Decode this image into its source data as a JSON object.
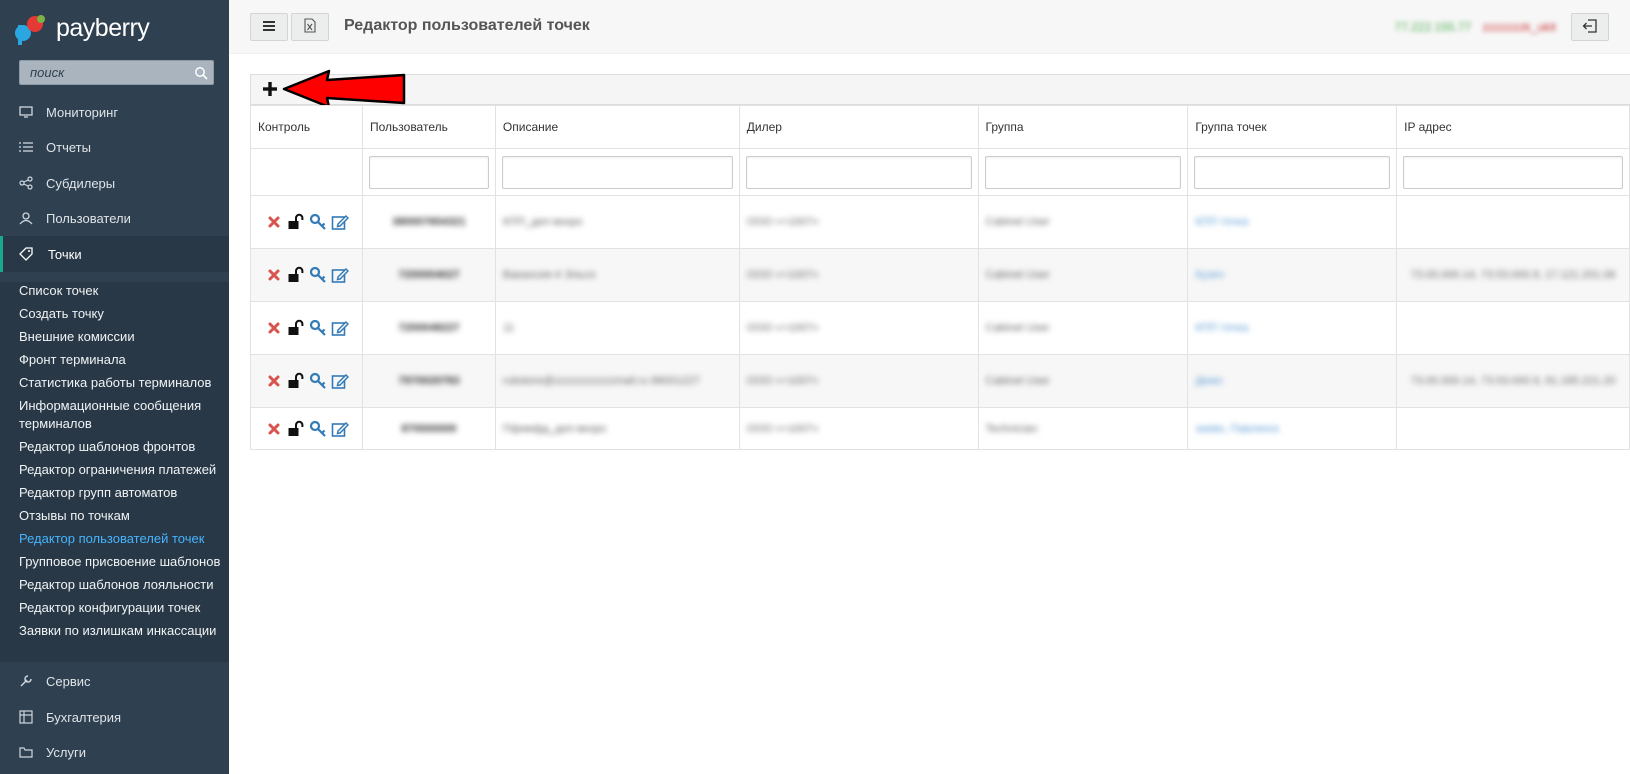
{
  "brand": {
    "name": "payberry"
  },
  "search": {
    "placeholder": "поиск"
  },
  "nav": {
    "monitoring": "Мониторинг",
    "reports": "Отчеты",
    "subdealers": "Субдилеры",
    "users": "Пользователи",
    "points": "Точки",
    "service": "Сервис",
    "accounting": "Бухгалтерия",
    "services": "Услуги"
  },
  "submenu": [
    "Список точек",
    "Создать точку",
    "Внешние комиссии",
    "Фронт терминала",
    "Статистика работы терминалов",
    "Информационные сообщения терминалов",
    "Редактор шаблонов фронтов",
    "Редактор ограничения платежей",
    "Редактор групп автоматов",
    "Отзывы по точкам",
    "Редактор пользователей точек",
    "Групповое присвоение шаблонов",
    "Редактор шаблонов лояльности",
    "Редактор конфигурации точек",
    "Заявки по излишкам инкассации"
  ],
  "topbar": {
    "title": "Редактор пользователей точек",
    "ip": "77.222.155.77",
    "username": "zzzzzzzk_ukit"
  },
  "table": {
    "headers": [
      "Контроль",
      "Пользователь",
      "Описание",
      "Дилер",
      "Группа",
      "Группа точек",
      "IP адрес"
    ],
    "rows": [
      {
        "user": "380007654321",
        "desc": "КПП_деп-вкоро",
        "dealer": "ООО «+1007»",
        "group": "Cabinet User",
        "point_group": "КПП точка",
        "ip": ""
      },
      {
        "user": "7200004027",
        "desc": "Вакансия-4 Эльсо",
        "dealer": "ООО «+1007»",
        "group": "Cabinet User",
        "point_group": "Кузич",
        "ip": "73.00.000.14, 73.53.000.9, 17.121.201.06"
      },
      {
        "user": "7200048227",
        "desc": "11",
        "dealer": "ООО «+1007»",
        "group": "Cabinet User",
        "point_group": "КПП точка",
        "ip": ""
      },
      {
        "user": "7970020783",
        "desc": "rubstore@zzzzzzzzzzzmail.ru 88001227",
        "dealer": "ООО «+1007»",
        "group": "Cabinet User",
        "point_group": "Демо",
        "ip": "73.00.000.14, 73.53.000.9, 91.185.221.20"
      },
      {
        "user": "870000000",
        "desc": "Пфимфд_деп-вкоро",
        "dealer": "ООО «+1007»",
        "group": "Technician",
        "point_group": "заяво, Павлинск",
        "ip": ""
      }
    ]
  },
  "colors": {
    "sidebar": "#2f4050",
    "accent": "#46b4ff",
    "delete": "#d9534f",
    "edit": "#337ab7"
  }
}
